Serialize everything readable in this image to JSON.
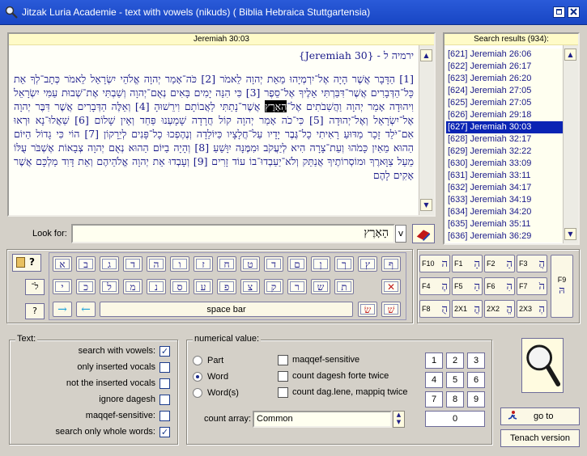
{
  "window": {
    "title": "Jitzak Luria Academie - text with vowels (nikuds)  ( Biblia Hebraica Stuttgartensia)"
  },
  "text_panel": {
    "reference": "Jeremiah 30:03",
    "heading_hebrew": "ירמיה ל - {Jeremiah 30}",
    "paragraphs": [
      "[1] הַדָּבָר אֲשֶׁר הָיָה אֶל־יִרְמְיָהוּ מֵאֵת יְהוָה לֵאמֹר [2] כֹּה־אָמַר יְהוָה אֱלֹהֵי יִשְׂרָאֵל לֵאמֹר כְּתָב־לְךָ אֵת כָּל־הַדְּבָרִים אֲשֶׁר־דִּבַּרְתִּי אֵלֶיךָ אֶל־סֵפֶר [3] כִּי הִנֵּה יָמִים בָּאִים נְאֻם־יְהוָה וְשַׁבְתִּי אֶת־שְׁבוּת עַמִּי יִשְׂרָאֵל וִיהוּדָה אָמַר יְהוָה וַהֲשִׁבֹתִים",
      "אֶל־",
      "הָאָרֶץ",
      " אֲשֶׁר־נָתַתִּי לַאֲבוֹתָם וִירֵשׁוּהָ",
      "[4] וְאֵלֶּה הַדְּבָרִים אֲשֶׁר דִּבֶּר יְהוָה אֶל־יִשְׂרָאֵל וְאֶל־יְהוּדָה [5] כִּי־כֹה אָמַר יְהוָה קוֹל חֲרָדָה שָׁמָעְנוּ פַּחַד וְאֵין שָׁלוֹם [6] שַׁאֲלוּ־נָא וּרְאוּ אִם־יֹלֵד זָכָר מַדּוּעַ רָאִיתִי כָל־גֶּבֶר יָדָיו עַל־חֲלָצָיו כַּיּוֹלֵדָה וְנֶהֶפְכוּ כָל־פָּנִים לְיֵרָקוֹן [7] הוֹי כִּי גָדוֹל הַיּוֹם הַהוּא מֵאַיִן כָּמֹהוּ וְעֵת־צָרָה הִיא לְיַעֲקֹב וּמִמֶּנָּה יִוָּשֵׁעַ [8] וְהָיָה בַיּוֹם הַהוּא נְאֻם יְהוָה צְבָאוֹת אֶשְׁבֹּר עֻלּוֹ מֵעַל צַוָּארֶךָ וּמוֹסְרוֹתֶיךָ אֲנַתֵּק וְלֹא־יַעַבְדוּ־בוֹ עוֹד זָרִים [9] וְעָבְדוּ אֵת יְהוָה אֱלֹהֵיהֶם וְאֵת דָּוִד מַלְכָּם אֲשֶׁר אָקִים לָהֶם"
    ]
  },
  "search_results": {
    "header": "Search results (934):",
    "items": [
      "[621] Jeremiah 26:06",
      "[622] Jeremiah 26:17",
      "[623] Jeremiah 26:20",
      "[624] Jeremiah 27:05",
      "[625] Jeremiah 27:05",
      "[626] Jeremiah 29:18",
      "[627] Jeremiah 30:03",
      "[628] Jeremiah 32:17",
      "[629] Jeremiah 32:22",
      "[630] Jeremiah 33:09",
      "[631] Jeremiah 33:11",
      "[632] Jeremiah 34:17",
      "[633] Jeremiah 34:19",
      "[634] Jeremiah 34:20",
      "[635] Jeremiah 35:11",
      "[636] Jeremiah 36:29"
    ],
    "selected_index": 6
  },
  "look_for": {
    "label": "Look for:",
    "value": "הָאָרֶץ",
    "v_label": "v"
  },
  "keyboard": {
    "row1": [
      "ף",
      "ץ",
      "ך",
      "ן",
      "ם",
      "ד",
      "ט",
      "ח",
      "ז",
      "ו",
      "ה",
      "ד",
      "ג",
      "ב",
      "א"
    ],
    "row2": [
      "ת",
      "ש",
      "ר",
      "ק",
      "צ",
      "פ",
      "ע",
      "ס",
      "נ",
      "מ",
      "ל",
      "כ",
      "י"
    ],
    "row2_clear": "✕",
    "row3_left_arrow": "→",
    "row3_right_arrow": "←",
    "spacebar": "space bar",
    "row3_keys": [
      "שׂ",
      "שׁ"
    ],
    "side_buttons": [
      "?",
      "ל־",
      "?"
    ],
    "fkeys": [
      {
        "label": "F10",
        "char": "ה"
      },
      {
        "label": "F1",
        "char": "הָ"
      },
      {
        "label": "F2",
        "char": "הַ"
      },
      {
        "label": "F3",
        "char": "הֲ"
      },
      {
        "label": "F4",
        "char": "הֶ"
      },
      {
        "label": "F5",
        "char": "הֵ"
      },
      {
        "label": "F6",
        "char": "הִ"
      },
      {
        "label": "F7",
        "char": "הֹ"
      },
      {
        "label": "F8",
        "char": "הֻ"
      },
      {
        "label": "2X1",
        "char": "הֳ"
      },
      {
        "label": "2X2",
        "char": "הֱ"
      },
      {
        "label": "2X3",
        "char": "הְ"
      }
    ],
    "f9": {
      "label": "F9",
      "char": "הּ"
    }
  },
  "text_options": {
    "title": "Text:",
    "items": [
      {
        "label": "search with vowels:",
        "checked": true
      },
      {
        "label": "only inserted vocals",
        "checked": false
      },
      {
        "label": "not the inserted vocals",
        "checked": false
      },
      {
        "label": "ignore dagesh",
        "checked": false
      },
      {
        "label": "maqqef-sensitive:",
        "checked": false
      },
      {
        "label": "search only whole words:",
        "checked": true
      }
    ]
  },
  "numerical": {
    "title": "numerical value:",
    "radios": [
      {
        "label": "Part",
        "selected": false
      },
      {
        "label": "Word",
        "selected": true
      },
      {
        "label": "Word(s)",
        "selected": false
      }
    ],
    "checks": [
      {
        "label": "maqqef-sensitive",
        "checked": false
      },
      {
        "label": "count dagesh forte twice",
        "checked": false
      },
      {
        "label": "count dag.lene, mappiq twice",
        "checked": false
      }
    ],
    "count_array_label": "count array:",
    "count_array_value": "Common",
    "numpad": [
      "1",
      "2",
      "3",
      "4",
      "5",
      "6",
      "7",
      "8",
      "9",
      "0"
    ]
  },
  "buttons": {
    "go_to": "go to",
    "tenach": "Tenach version"
  }
}
